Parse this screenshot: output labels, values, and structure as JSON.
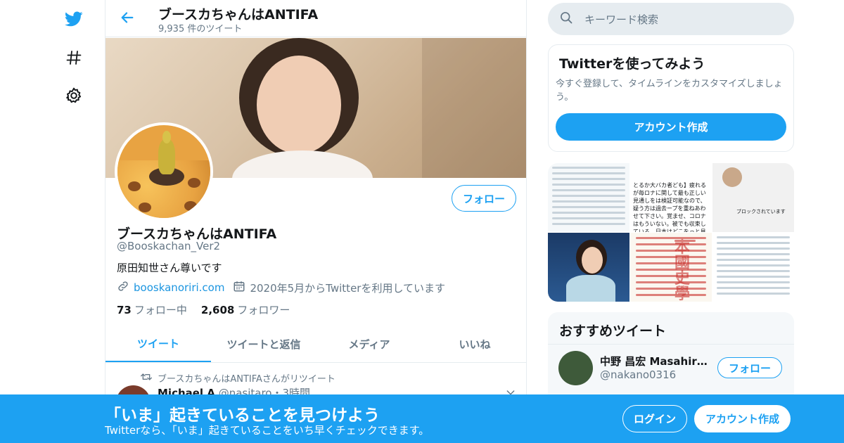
{
  "header": {
    "name": "ブースカちゃんはANTIFA",
    "tweet_count": "9,935 件のツイート"
  },
  "profile": {
    "name": "ブースカちゃんはANTIFA",
    "handle": "@Booskachan_Ver2",
    "bio": "原田知世さん尊いです",
    "website": "booskanoriri.com",
    "joined": "2020年5月からTwitterを利用しています",
    "following_count": "73",
    "following_label": "フォロー中",
    "followers_count": "2,608",
    "followers_label": "フォロワー",
    "follow_label": "フォロー"
  },
  "tabs": [
    {
      "label": "ツイート",
      "active": true
    },
    {
      "label": "ツイートと返信",
      "active": false
    },
    {
      "label": "メディア",
      "active": false
    },
    {
      "label": "いいね",
      "active": false
    }
  ],
  "tweet": {
    "retweet_label": "ブースカちゃんはANTIFAさんがリツイート",
    "author_name": "Michael A",
    "author_handle": "@nasitaro",
    "time": "・3時間"
  },
  "search": {
    "placeholder": "キーワード検索"
  },
  "signup_card": {
    "title": "Twitterを使ってみよう",
    "description": "今すぐ登録して、タイムラインをカスタマイズしましょう。",
    "button": "アカウント作成"
  },
  "media_preview": {
    "snippet": "とるか大バカ者ども】疲れるが毎ロナに関して最も正しい見通しをは検証可能なので、疑う方は過去ープを重ねあわせて下さい。覚ませ、コロナはもういない。被でも収束している。日本はどこをっと見る",
    "blocked": "ブロックされています",
    "book_title": "本國史學"
  },
  "recommended": {
    "title": "おすすめツイート",
    "user_name": "中野 昌宏 Masahiro ...",
    "user_handle": "@nakano0316",
    "follow_label": "フォロー"
  },
  "bottom_bar": {
    "title": "「いま」起きていることを見つけよう",
    "subtitle": "Twitterなら、「いま」起きていることをいち早くチェックできます。",
    "login": "ログイン",
    "signup": "アカウント作成"
  },
  "colors": {
    "accent": "#1da1f2",
    "text_secondary": "#657786",
    "border": "#e6ecf0"
  },
  "icons": [
    "twitter-logo-icon",
    "hashtag-icon",
    "gear-icon",
    "back-arrow-icon",
    "link-icon",
    "calendar-icon",
    "retweet-icon",
    "chevron-down-icon",
    "search-icon"
  ]
}
